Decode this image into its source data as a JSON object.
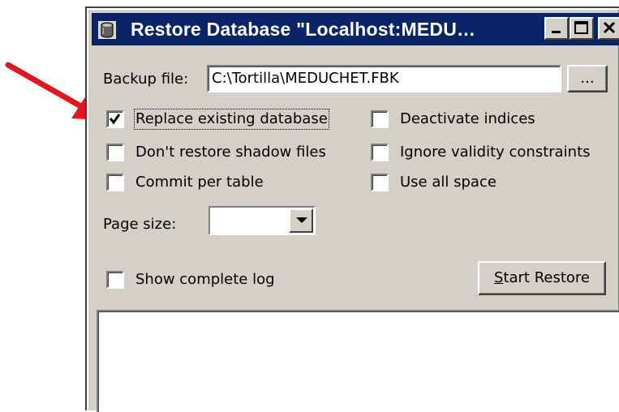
{
  "window": {
    "title": "Restore Database \"Localhost:MEDU…",
    "app_icon": "database-icon",
    "controls": {
      "minimize": "minimize-icon",
      "maximize": "maximize-icon",
      "close": "close-icon"
    }
  },
  "backup": {
    "label": "Backup file:",
    "value": "C:\\Tortilla\\MEDUCHET.FBK",
    "browse_label": "..."
  },
  "options": {
    "replace_existing": {
      "label": "Replace existing database",
      "checked": true
    },
    "dont_restore_shadow": {
      "label": "Don't restore shadow files",
      "checked": false
    },
    "commit_per_table": {
      "label": "Commit per table",
      "checked": false
    },
    "deactivate_indices": {
      "label": "Deactivate indices",
      "checked": false
    },
    "ignore_validity": {
      "label": "Ignore validity constraints",
      "checked": false
    },
    "use_all_space": {
      "label": "Use all space",
      "checked": false
    }
  },
  "page_size": {
    "label": "Page size:",
    "value": ""
  },
  "show_log": {
    "label": "Show complete log",
    "checked": false
  },
  "start_restore": {
    "label_rest": "tart Restore",
    "label_mnemonic": "S"
  },
  "annotation": {
    "icon": "red-arrow-icon",
    "color": "#e8141c"
  },
  "colors": {
    "titlebar": "#0a246a",
    "face": "#d4d0c8"
  }
}
